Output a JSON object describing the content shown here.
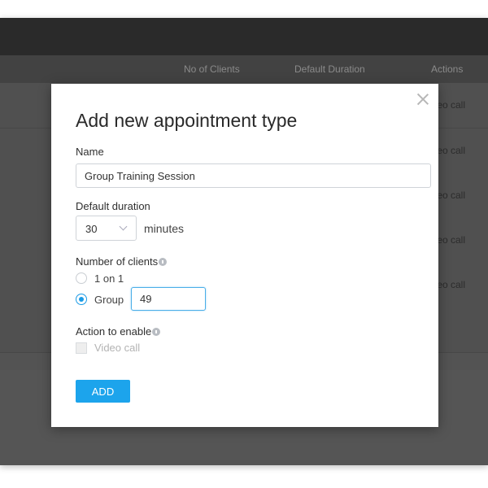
{
  "table": {
    "headers": {
      "clients": "No of Clients",
      "duration": "Default Duration",
      "actions": "Actions"
    },
    "row_actions": [
      "eo call",
      "eo call",
      "eo call",
      "eo call",
      "eo call"
    ]
  },
  "modal": {
    "title": "Add new appointment type",
    "name_label": "Name",
    "name_value": "Group Training Session",
    "duration_label": "Default duration",
    "duration_value": "30",
    "duration_unit": "minutes",
    "clients_label": "Number of clients",
    "option_one": "1 on 1",
    "option_group": "Group",
    "group_value": "49",
    "action_label": "Action to enable",
    "video_call_label": "Video call",
    "add_button": "ADD"
  },
  "colors": {
    "accent": "#1ca4ec",
    "overlay": "#535353"
  }
}
